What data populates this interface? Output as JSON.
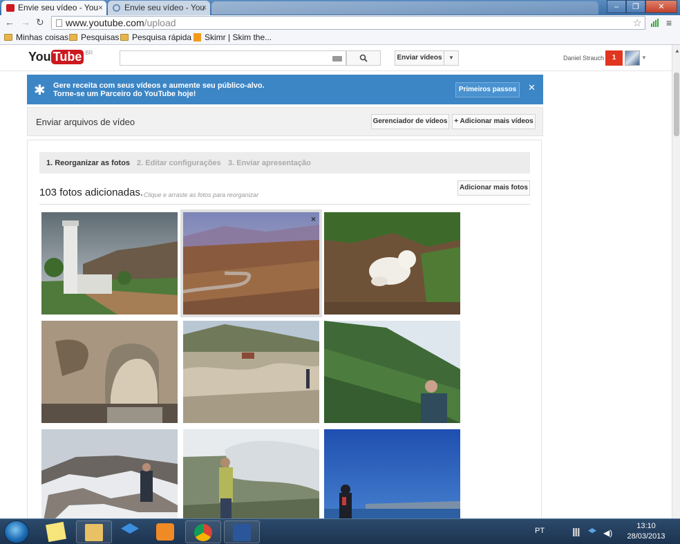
{
  "browser": {
    "tabs": [
      {
        "label": "Envie seu vídeo - You",
        "active": true
      },
      {
        "label": "Envie seu vídeo - You",
        "active": false
      }
    ],
    "url_host": "www.youtube.com",
    "url_path": "/upload",
    "bookmarks": [
      "Minhas coisas",
      "Pesquisas",
      "Pesquisa rápida",
      "Skimr | Skim the..."
    ]
  },
  "header": {
    "logo_you": "You",
    "logo_tube": "Tube",
    "logo_region": "BR",
    "upload_label": "Enviar vídeos",
    "username": "Daniel Strauch",
    "notifications": "1"
  },
  "promo": {
    "line1": "Gere receita com seus vídeos e aumente seu público-alvo.",
    "line2": "Torne-se um Parceiro do YouTube hoje!",
    "button": "Primeiros passos"
  },
  "upload": {
    "title": "Enviar arquivos de vídeo",
    "manager_button": "Gerenciador de vídeos",
    "add_more_button": "+ Adicionar mais vídeos"
  },
  "steps": [
    "1. Reorganizar as fotos",
    "2. Editar configurações",
    "3. Enviar apresentação"
  ],
  "photos": {
    "count_label": "103 fotos adicionadas.",
    "hint": "Clique e arraste as fotos para reorganizar",
    "add_button": "Adicionar mais fotos",
    "remove_glyph": "×"
  },
  "taskbar": {
    "lang": "PT",
    "time": "13:10",
    "date": "28/03/2013"
  },
  "colors": {
    "yt_red": "#cc181e",
    "promo_blue": "#3d86c6",
    "notif_red": "#e1351f"
  }
}
